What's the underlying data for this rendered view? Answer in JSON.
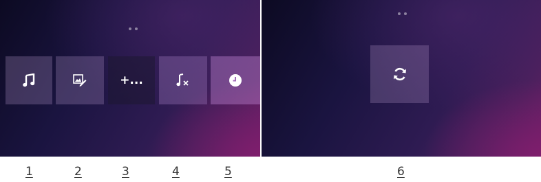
{
  "panels": [
    {
      "id": "left",
      "tiles": [
        {
          "icon": "music-note-icon"
        },
        {
          "icon": "edit-image-icon"
        },
        {
          "icon": "plus-more-icon",
          "text": "+..."
        },
        {
          "icon": "remove-music-icon"
        },
        {
          "icon": "clock-icon"
        }
      ]
    },
    {
      "id": "right",
      "tiles": [
        {
          "icon": "refresh-icon"
        }
      ]
    }
  ],
  "captions": [
    "1",
    "2",
    "3",
    "4",
    "5",
    "6"
  ],
  "colors": {
    "background_dark": "#0c0a22",
    "background_purple": "#4a1f5c",
    "background_magenta": "#6b1f66",
    "tile_light": "#8a6fa0",
    "tile_dark": "#241c38",
    "tile_highlight": "#a06ab8",
    "icon": "#ffffff",
    "caption": "#333333"
  }
}
